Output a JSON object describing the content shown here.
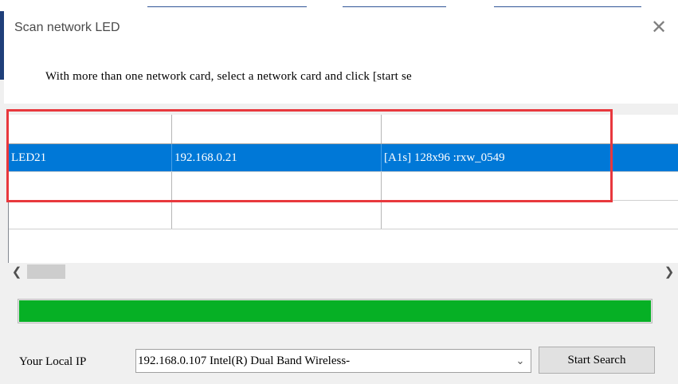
{
  "window": {
    "title": "Scan network LED"
  },
  "instruction": "With more than one network card, select a network card and click [start se",
  "table": {
    "columns": [
      "",
      "",
      ""
    ],
    "rows": [
      [
        "LED21",
        "192.168.0.21",
        "[A1s] 128x96 :rxw_0549"
      ],
      [
        "",
        "",
        ""
      ],
      [
        "",
        "",
        ""
      ]
    ],
    "selected_row": 0
  },
  "progress": {
    "value": 1.0
  },
  "local_ip": {
    "label": "Your Local IP",
    "selected": "192.168.0.107  Intel(R) Dual Band Wireless-"
  },
  "buttons": {
    "start_search": "Start Search"
  },
  "icons": {
    "close": "close-icon",
    "scroll_left": "chevron-left-icon",
    "scroll_right": "chevron-right-icon",
    "dropdown": "chevron-down-icon"
  },
  "colors": {
    "selection": "#0078d7",
    "progress": "#06b025",
    "annotation": "#e8383d"
  }
}
